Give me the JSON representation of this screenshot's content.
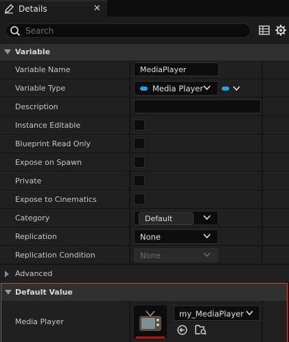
{
  "tab": {
    "title": "Details",
    "close": "✕"
  },
  "search": {
    "placeholder": "Search"
  },
  "categories": {
    "variable": "Variable",
    "default_value": "Default Value"
  },
  "properties": {
    "variable_name": {
      "label": "Variable Name",
      "value": "MediaPlayer"
    },
    "variable_type": {
      "label": "Variable Type",
      "value": "Media Player"
    },
    "description": {
      "label": "Description",
      "value": ""
    },
    "instance_editable": {
      "label": "Instance Editable"
    },
    "blueprint_read_only": {
      "label": "Blueprint Read Only"
    },
    "expose_on_spawn": {
      "label": "Expose on Spawn"
    },
    "private": {
      "label": "Private"
    },
    "expose_to_cinematics": {
      "label": "Expose to Cinematics"
    },
    "category": {
      "label": "Category",
      "value": "Default"
    },
    "replication": {
      "label": "Replication",
      "value": "None"
    },
    "replication_condition": {
      "label": "Replication Condition",
      "value": "None"
    }
  },
  "advanced": {
    "label": "Advanced"
  },
  "default_value": {
    "media_player": {
      "label": "Media Player",
      "asset": "my_MediaPlayer"
    }
  },
  "colors": {
    "pin_blue": "#1aa3ef",
    "highlight_border": "#c2553a",
    "thumb_bar": "#c01010"
  }
}
